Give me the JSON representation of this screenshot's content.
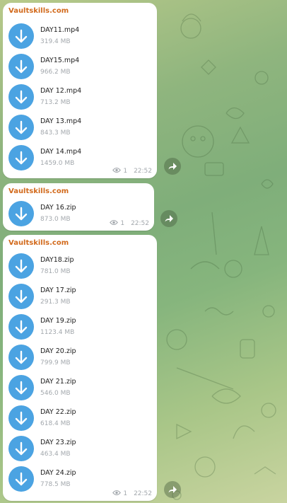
{
  "sender_name": "Vaultskills.com",
  "messages": [
    {
      "files": [
        {
          "name": "DAY11.mp4",
          "size": "319.4 MB"
        },
        {
          "name": "DAY15.mp4",
          "size": "966.2 MB"
        },
        {
          "name": "DAY 12.mp4",
          "size": "713.2 MB"
        },
        {
          "name": "DAY 13.mp4",
          "size": "843.3 MB"
        },
        {
          "name": "DAY 14.mp4",
          "size": "1459.0 MB"
        }
      ],
      "views": "1",
      "time": "22:52"
    },
    {
      "files": [
        {
          "name": "DAY 16.zip",
          "size": "873.0 MB"
        }
      ],
      "views": "1",
      "time": "22:52"
    },
    {
      "files": [
        {
          "name": "DAY18.zip",
          "size": "781.0 MB"
        },
        {
          "name": "DAY 17.zip",
          "size": "291.3 MB"
        },
        {
          "name": "DAY 19.zip",
          "size": "1123.4 MB"
        },
        {
          "name": "DAY 20.zip",
          "size": "799.9 MB"
        },
        {
          "name": "DAY 21.zip",
          "size": "546.0 MB"
        },
        {
          "name": "DAY 22.zip",
          "size": "618.4 MB"
        },
        {
          "name": "DAY 23.zip",
          "size": "463.4 MB"
        },
        {
          "name": "DAY 24.zip",
          "size": "778.5 MB"
        }
      ],
      "views": "1",
      "time": "22:52"
    }
  ],
  "icons": {
    "download": "download-arrow-icon",
    "views": "eye-icon",
    "share": "share-arrow-icon"
  },
  "colors": {
    "accent": "#4ba3e2",
    "sender": "#d26a1c",
    "meta_text": "#a3a8ad"
  }
}
